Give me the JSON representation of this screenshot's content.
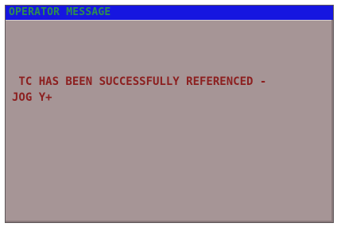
{
  "window": {
    "title": "OPERATOR MESSAGE"
  },
  "message": {
    "line1": " TC HAS BEEN SUCCESSFULLY REFERENCED -",
    "line2": "JOG Y+"
  },
  "colors": {
    "title_bar_bg": "#1616e0",
    "title_text": "#2e8f4e",
    "panel_bg": "#a69596",
    "message_text": "#8c1f1f"
  }
}
